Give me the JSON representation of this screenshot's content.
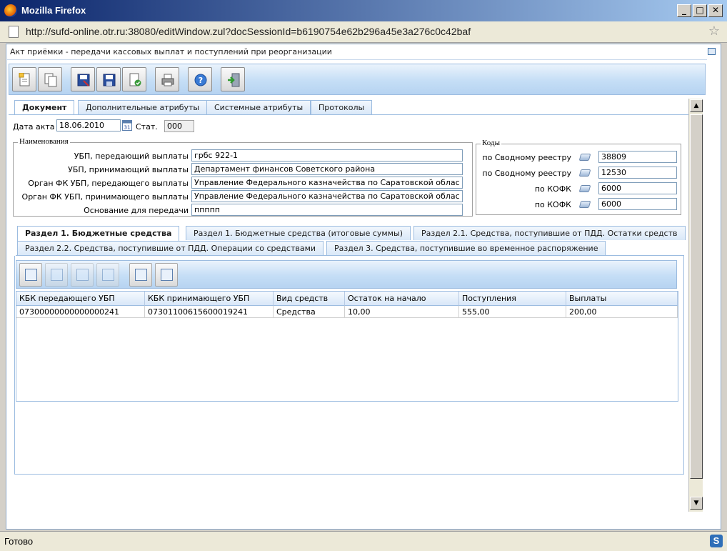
{
  "window": {
    "title": "Mozilla Firefox",
    "minimize": "_",
    "maximize": "□",
    "close": "✕"
  },
  "urlbar": {
    "url": "http://sufd-online.otr.ru:38080/editWindow.zul?docSessionId=b6190754e62b296a45e3a276c0c42baf"
  },
  "doc": {
    "title": "Акт приёмки - передачи кассовых выплат и поступлений при реорганизации"
  },
  "toolbar": {
    "icons": [
      "new-document-icon",
      "copy-document-icon",
      "save-close-icon",
      "save-icon",
      "check-document-icon",
      "print-icon",
      "help-icon",
      "exit-icon"
    ]
  },
  "tabs": [
    "Документ",
    "Дополнительные атрибуты",
    "Системные атрибуты",
    "Протоколы"
  ],
  "form": {
    "date_label": "Дата акта",
    "date_value": "18.06.2010",
    "status_label": "Стат.",
    "status_value": "000",
    "names_legend": "Наименования",
    "codes_legend": "Коды",
    "names": [
      {
        "label": "УБП, передающий выплаты",
        "value": "грбс 922-1"
      },
      {
        "label": "УБП, принимающий выплаты",
        "value": "Департамент финансов Советского района"
      },
      {
        "label": "Орган ФК УБП, передающего выплаты",
        "value": "Управление Федерального казначейства по Саратовской облас"
      },
      {
        "label": "Орган ФК УБП, принимающего выплаты",
        "value": "Управление Федерального казначейства по Саратовской облас"
      },
      {
        "label": "Основание для передачи",
        "value": "ппппп"
      }
    ],
    "codes": [
      {
        "label": "по Сводному реестру",
        "value": "38809"
      },
      {
        "label": "по Сводному реестру",
        "value": "12530"
      },
      {
        "label": "по КОФК",
        "value": "6000"
      },
      {
        "label": "по КОФК",
        "value": "6000"
      }
    ]
  },
  "section_tabs_row1": [
    "Раздел 1. Бюджетные средства",
    "Раздел 1. Бюджетные средства (итоговые суммы)",
    "Раздел 2.1. Средства, поступившие от ПДД. Остатки средств"
  ],
  "section_tabs_row2": [
    "Раздел 2.2. Средства, поступившие от ПДД. Операции со средствами",
    "Раздел 3. Средства, поступившие во временное распоряжение"
  ],
  "grid": {
    "columns": [
      "КБК передающего УБП",
      "КБК принимающего УБП",
      "Вид средств",
      "Остаток на начало",
      "Поступления",
      "Выплаты"
    ],
    "rows": [
      [
        "07300000000000000241",
        "07301100615600019241",
        "Средства",
        "10,00",
        "555,00",
        "200,00"
      ]
    ]
  },
  "status": {
    "text": "Готово",
    "icon_letter": "S"
  }
}
